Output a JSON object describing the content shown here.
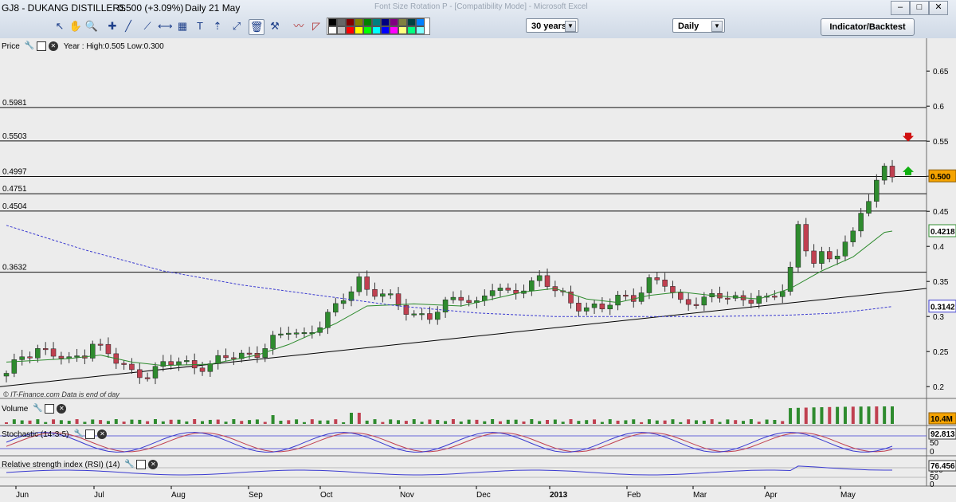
{
  "window": {
    "symbol_text": "GJ8 - DUKANG DISTILLERS",
    "price_text": "0.500 (+3.09%)",
    "period_text": "Daily 21 May",
    "faded_title": "Font Size Rotation P - [Compatibility Mode] - Microsoft Excel"
  },
  "toolbar": {
    "range_select": "30 years",
    "interval_select": "Daily",
    "indicator_button": "Indicator/Backtest"
  },
  "colors": {
    "up_candle": "#2e8b2e",
    "down_candle": "#c04050",
    "ma_short": "#2e8b2e",
    "ma_long": "#3a3ad0",
    "trendline": "#000000",
    "background": "#ececec"
  },
  "icons": [
    "pointer-icon",
    "zoom-icon",
    "magnify-icon",
    "cross-icon",
    "line-icon",
    "line-icon",
    "horizontal-line-icon",
    "channel-icon",
    "fibonacci-icon",
    "text-icon",
    "arrow-up-icon",
    "diagonal-icon",
    "trash-icon",
    "tools-icon",
    "wave-icon",
    "triangle-icon"
  ],
  "price_pane": {
    "label": "Price",
    "info": "Year : High:0.505 Low:0.300",
    "watermark": "© IT-Finance.com   Data is end of day",
    "last_price_tag": "0.500",
    "ma_short_tag": "0.4218",
    "ma_long_tag": "0.3142"
  },
  "volume_pane": {
    "label": "Volume",
    "tag": "10.4M"
  },
  "stoch_pane": {
    "label": "Stochastic (14-3-5)",
    "tag": "92.813",
    "ticks": [
      "100",
      "50",
      "0"
    ]
  },
  "rsi_pane": {
    "label": "Relative strength index (RSI) (14)",
    "tag": "76.456",
    "ticks": [
      "100",
      "50",
      "0"
    ]
  },
  "chart_data": {
    "type": "candlestick",
    "ylim": [
      0.19,
      0.69
    ],
    "y_ticks": [
      "0.65",
      "0.6",
      "0.55",
      "0.5",
      "0.45",
      "0.4",
      "0.35",
      "0.3",
      "0.25",
      "0.2"
    ],
    "x_months": [
      "Jun",
      "Jul",
      "Aug",
      "Sep",
      "Oct",
      "Nov",
      "Dec",
      "2013",
      "Feb",
      "Mar",
      "Apr",
      "May"
    ],
    "levels": [
      {
        "label": "0.5981",
        "value": 0.5981
      },
      {
        "label": "0.5503",
        "value": 0.5503
      },
      {
        "label": "0.4997",
        "value": 0.4997
      },
      {
        "label": "0.4751",
        "value": 0.4751
      },
      {
        "label": "0.4504",
        "value": 0.4504
      },
      {
        "label": "0.3632",
        "value": 0.3632
      }
    ],
    "trendline": {
      "start": 0.2,
      "end": 0.34
    },
    "close_path": [
      [
        0,
        0.215
      ],
      [
        2,
        0.245
      ],
      [
        4,
        0.255
      ],
      [
        6,
        0.245
      ],
      [
        8,
        0.235
      ],
      [
        10,
        0.25
      ],
      [
        11,
        0.265
      ],
      [
        12,
        0.255
      ],
      [
        14,
        0.235
      ],
      [
        16,
        0.22
      ],
      [
        18,
        0.22
      ],
      [
        20,
        0.23
      ],
      [
        22,
        0.235
      ],
      [
        24,
        0.23
      ],
      [
        26,
        0.232
      ],
      [
        28,
        0.24
      ],
      [
        30,
        0.245
      ],
      [
        32,
        0.25
      ],
      [
        34,
        0.265
      ],
      [
        35,
        0.27
      ],
      [
        36,
        0.28
      ],
      [
        38,
        0.275
      ],
      [
        40,
        0.29
      ],
      [
        42,
        0.31
      ],
      [
        44,
        0.34
      ],
      [
        45,
        0.355
      ],
      [
        46,
        0.34
      ],
      [
        48,
        0.33
      ],
      [
        50,
        0.315
      ],
      [
        52,
        0.305
      ],
      [
        54,
        0.3
      ],
      [
        56,
        0.315
      ],
      [
        58,
        0.33
      ],
      [
        60,
        0.32
      ],
      [
        62,
        0.34
      ],
      [
        64,
        0.33
      ],
      [
        66,
        0.345
      ],
      [
        68,
        0.355
      ],
      [
        70,
        0.335
      ],
      [
        72,
        0.32
      ],
      [
        74,
        0.315
      ],
      [
        76,
        0.31
      ],
      [
        78,
        0.325
      ],
      [
        80,
        0.33
      ],
      [
        82,
        0.35
      ],
      [
        84,
        0.345
      ],
      [
        86,
        0.32
      ],
      [
        88,
        0.325
      ],
      [
        90,
        0.325
      ],
      [
        92,
        0.328
      ],
      [
        94,
        0.325
      ],
      [
        96,
        0.33
      ],
      [
        97,
        0.32
      ],
      [
        98,
        0.325
      ],
      [
        99,
        0.34
      ],
      [
        100,
        0.37
      ],
      [
        101,
        0.43
      ],
      [
        102,
        0.4
      ],
      [
        103,
        0.38
      ],
      [
        104,
        0.385
      ],
      [
        105,
        0.375
      ],
      [
        106,
        0.39
      ],
      [
        107,
        0.41
      ],
      [
        108,
        0.42
      ],
      [
        109,
        0.45
      ],
      [
        110,
        0.47
      ],
      [
        111,
        0.49
      ],
      [
        112,
        0.505
      ],
      [
        113,
        0.5
      ]
    ],
    "ma_short": [
      [
        0,
        0.235
      ],
      [
        8,
        0.24
      ],
      [
        12,
        0.245
      ],
      [
        16,
        0.235
      ],
      [
        20,
        0.23
      ],
      [
        26,
        0.232
      ],
      [
        32,
        0.245
      ],
      [
        36,
        0.26
      ],
      [
        42,
        0.29
      ],
      [
        46,
        0.315
      ],
      [
        52,
        0.318
      ],
      [
        58,
        0.315
      ],
      [
        62,
        0.325
      ],
      [
        66,
        0.335
      ],
      [
        70,
        0.34
      ],
      [
        74,
        0.325
      ],
      [
        78,
        0.32
      ],
      [
        82,
        0.33
      ],
      [
        86,
        0.335
      ],
      [
        90,
        0.33
      ],
      [
        96,
        0.325
      ],
      [
        100,
        0.34
      ],
      [
        104,
        0.365
      ],
      [
        108,
        0.385
      ],
      [
        112,
        0.42
      ],
      [
        113,
        0.4218
      ]
    ],
    "ma_long": [
      [
        0,
        0.43
      ],
      [
        10,
        0.395
      ],
      [
        20,
        0.365
      ],
      [
        30,
        0.345
      ],
      [
        40,
        0.33
      ],
      [
        50,
        0.315
      ],
      [
        60,
        0.305
      ],
      [
        70,
        0.3
      ],
      [
        80,
        0.3
      ],
      [
        90,
        0.3
      ],
      [
        100,
        0.302
      ],
      [
        106,
        0.305
      ],
      [
        110,
        0.31
      ],
      [
        113,
        0.3142
      ]
    ]
  }
}
